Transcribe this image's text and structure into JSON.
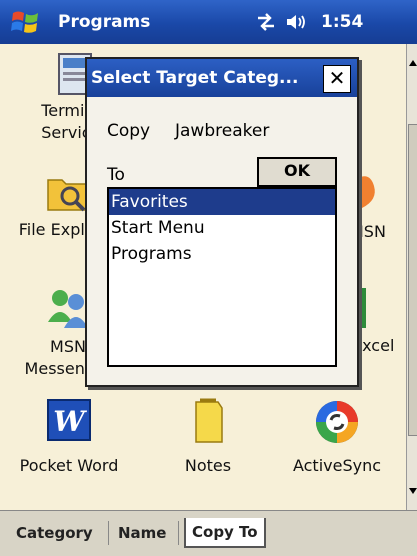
{
  "titlebar": {
    "title": "Programs",
    "time": "1:54"
  },
  "programs": [
    {
      "label": "Terminal Services"
    },
    {
      "label": "File Explorer"
    },
    {
      "label": "MSN Messenger"
    },
    {
      "label": "Pocket Word"
    },
    {
      "label": "Notes"
    },
    {
      "label": "ActiveSync"
    },
    {
      "label": "MSN"
    },
    {
      "label": "Excel"
    }
  ],
  "bottombar": {
    "tabs": [
      "Category",
      "Name",
      "Copy To"
    ],
    "active_tab": "Copy To"
  },
  "dialog": {
    "title": "Select Target Categ...",
    "close": "✕",
    "copy_label": "Copy",
    "copy_value": "Jawbreaker",
    "to_label": "To",
    "ok_label": "OK",
    "items": [
      "Favorites",
      "Start Menu",
      "Programs"
    ],
    "selected": "Favorites"
  },
  "colors": {
    "title_bar": "#1a48a8",
    "desktop": "#f7f0d8",
    "selection": "#1e3c8c"
  }
}
